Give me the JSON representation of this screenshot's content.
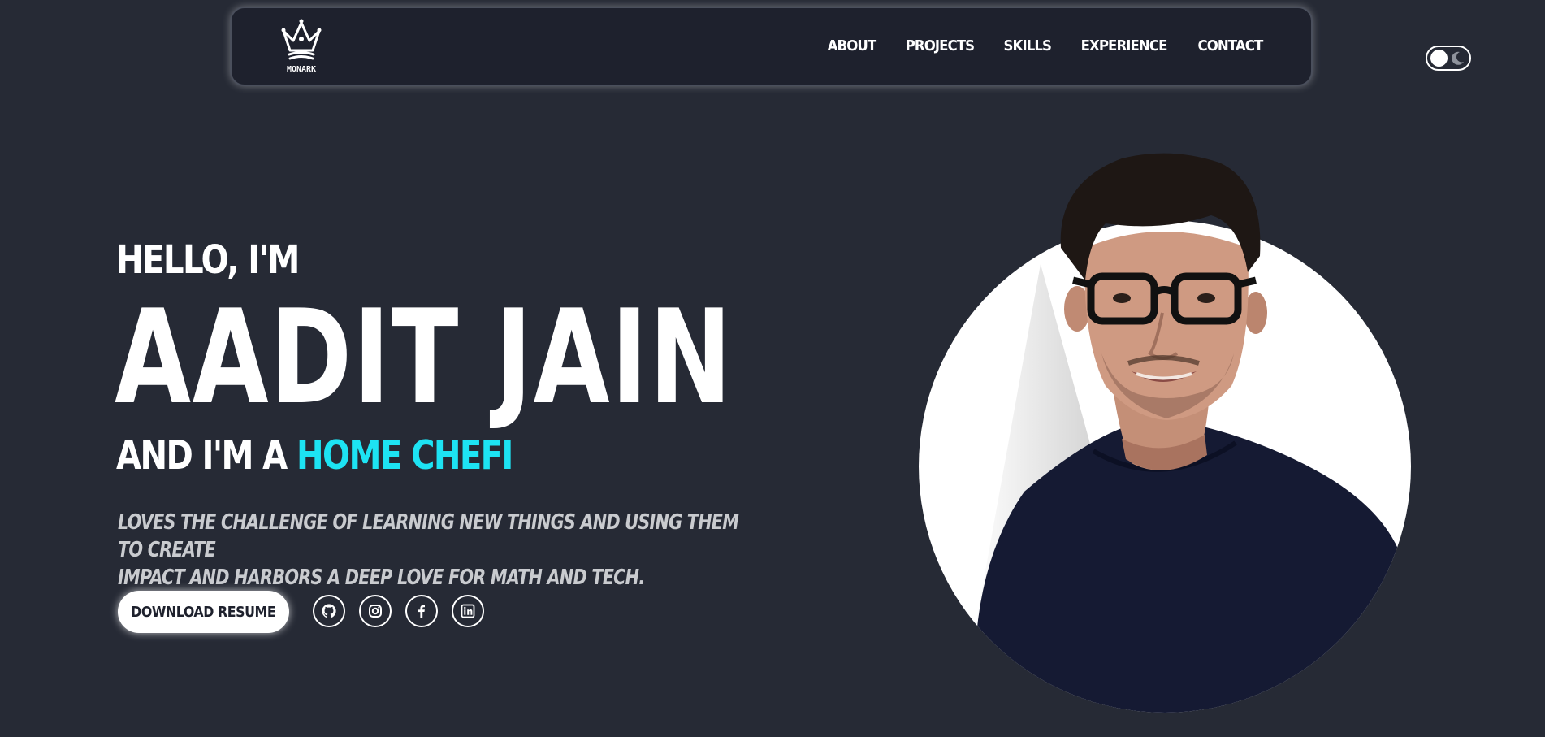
{
  "header": {
    "logo_text": "MONARK",
    "nav": [
      "ABOUT",
      "PROJECTS",
      "SKILLS",
      "EXPERIENCE",
      "CONTACT"
    ]
  },
  "theme_toggle": {
    "state": "light-knob",
    "icon": "moon-icon"
  },
  "hero": {
    "greeting": "HELLO, I'M",
    "name": "AADIT JAIN",
    "role_prefix": "AND I'M A ",
    "role": "HOME CHEFI",
    "tagline_line1": "LOVES THE CHALLENGE OF LEARNING NEW THINGS AND USING THEM TO CREATE",
    "tagline_line2": "IMPACT AND HARBORS A DEEP LOVE FOR MATH AND TECH.",
    "resume_button": "DOWNLOAD RESUME",
    "socials": [
      "github-icon",
      "instagram-icon",
      "facebook-icon",
      "linkedin-icon"
    ]
  },
  "colors": {
    "background": "#262a35",
    "nav_background": "#1e212d",
    "accent": "#1de3f3",
    "text": "#ffffff",
    "tagline": "#c9cbcf"
  }
}
